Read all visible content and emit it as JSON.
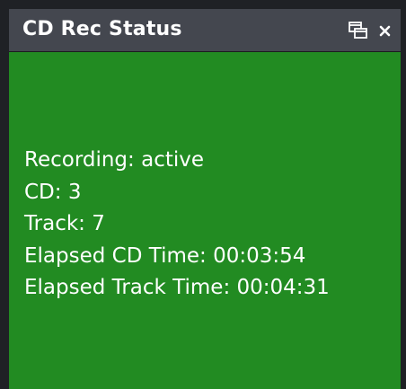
{
  "window": {
    "title": "CD Rec Status",
    "popout_icon": "popout-window-icon",
    "close_icon": "close-icon"
  },
  "colors": {
    "titlebar": "#44474f",
    "content_background": "#228b22",
    "text": "#ffffff"
  },
  "status": {
    "recording": "Recording: active",
    "cd": "CD: 3",
    "track": "Track: 7",
    "elapsed_cd_time": "Elapsed CD Time: 00:03:54",
    "elapsed_track_time": "Elapsed Track Time: 00:04:31"
  }
}
